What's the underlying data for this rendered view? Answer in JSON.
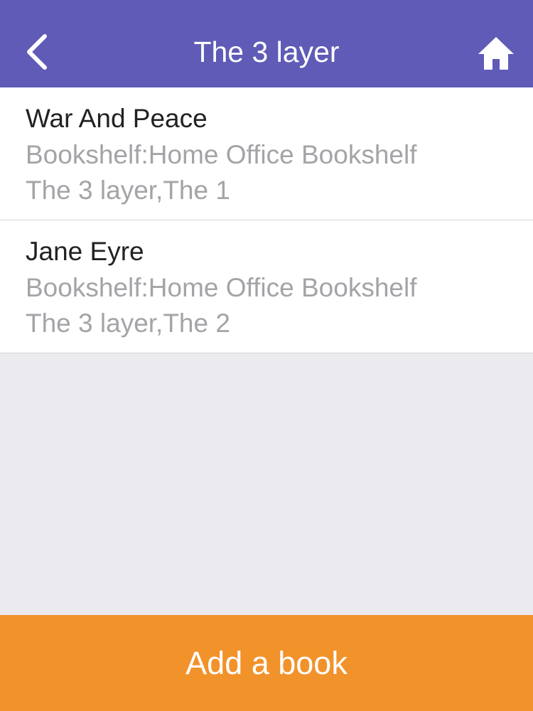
{
  "colors": {
    "nav_background": "#5f5bb6",
    "list_background": "#ffffff",
    "page_background": "#ebeaef",
    "title_text": "#222222",
    "subtitle_text": "#a4a4a8",
    "action_bar": "#f2922a",
    "white": "#ffffff"
  },
  "nav": {
    "title": "The 3 layer",
    "back_icon": "chevron-left-icon",
    "home_icon": "home-icon"
  },
  "books": [
    {
      "title": "War And Peace",
      "bookshelf": "Bookshelf:Home Office Bookshelf",
      "location": "The 3 layer,The 1"
    },
    {
      "title": "Jane Eyre",
      "bookshelf": "Bookshelf:Home Office Bookshelf",
      "location": "The 3 layer,The 2"
    }
  ],
  "action": {
    "add_label": "Add a book"
  }
}
